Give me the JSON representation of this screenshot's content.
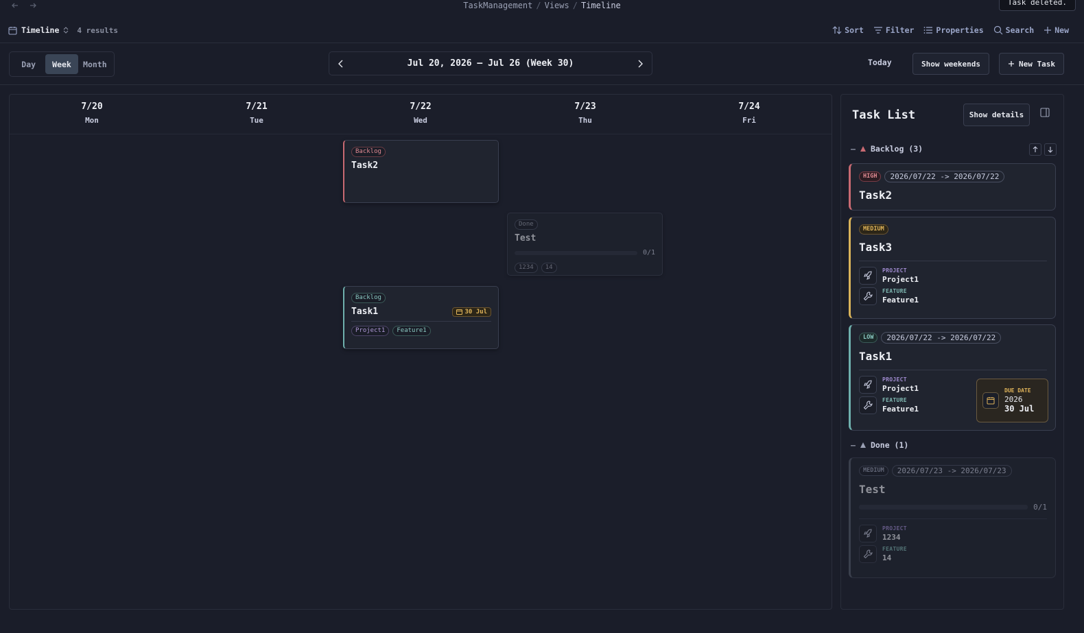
{
  "breadcrumb": {
    "root": "TaskManagement",
    "mid": "Views",
    "current": "Timeline",
    "sep": "/"
  },
  "toast": {
    "text": "Task deleted."
  },
  "viewbar": {
    "view_name": "Timeline",
    "results": "4 results"
  },
  "actions": {
    "sort": "Sort",
    "filter": "Filter",
    "properties": "Properties",
    "search": "Search",
    "new": "New"
  },
  "segment": {
    "day": "Day",
    "week": "Week",
    "month": "Month",
    "active": "Week"
  },
  "weeknav": {
    "label": "Jul 20, 2026 – Jul 26 (Week 30)"
  },
  "toolbar": {
    "today": "Today",
    "show_weekends": "Show weekends",
    "new_task": "New Task"
  },
  "calendar": {
    "days": [
      {
        "date": "7/20",
        "weekday": "Mon"
      },
      {
        "date": "7/21",
        "weekday": "Tue"
      },
      {
        "date": "7/22",
        "weekday": "Wed"
      },
      {
        "date": "7/23",
        "weekday": "Thu"
      },
      {
        "date": "7/24",
        "weekday": "Fri"
      }
    ],
    "cards": {
      "task2": {
        "status": "Backlog",
        "title": "Task2"
      },
      "test": {
        "status": "Done",
        "title": "Test",
        "progress": "0/1",
        "progress_fraction": 0,
        "tags": [
          "1234",
          "14"
        ]
      },
      "task1": {
        "status": "Backlog",
        "title": "Task1",
        "due": "30 Jul",
        "tags": [
          "Project1",
          "Feature1"
        ]
      }
    }
  },
  "panel": {
    "title": "Task List",
    "show_details": "Show details",
    "groups": {
      "backlog": {
        "label": "Backlog (3)",
        "collapse": "–"
      },
      "done": {
        "label": "Done (1)",
        "collapse": "–"
      }
    },
    "meta_keys": {
      "project": "PROJECT",
      "feature": "FEATURE",
      "due": "DUE DATE"
    },
    "cards": {
      "task2": {
        "priority": "HIGH",
        "range": "2026/07/22 -> 2026/07/22",
        "title": "Task2"
      },
      "task3": {
        "priority": "MEDIUM",
        "title": "Task3",
        "project": "Project1",
        "feature": "Feature1"
      },
      "task1": {
        "priority": "LOW",
        "range": "2026/07/22 -> 2026/07/22",
        "title": "Task1",
        "project": "Project1",
        "feature": "Feature1",
        "due_year": "2026",
        "due_day": "30 Jul"
      },
      "test": {
        "priority": "MEDIUM",
        "range": "2026/07/23 -> 2026/07/23",
        "title": "Test",
        "progress": "0/1",
        "progress_fraction": 0,
        "project": "1234",
        "feature": "14"
      }
    }
  },
  "colors": {
    "background": "#1a1d29",
    "high": "#c96a72",
    "medium": "#d9b35a",
    "low": "#6fb0ad",
    "due": "#e0b45a"
  }
}
